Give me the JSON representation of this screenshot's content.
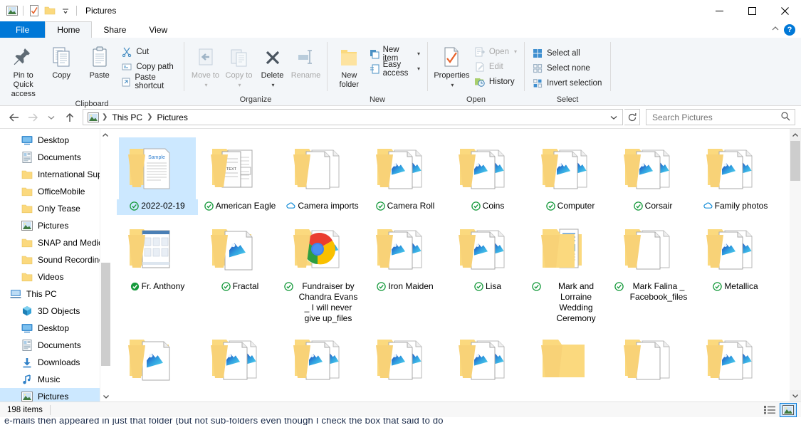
{
  "window": {
    "title": "Pictures",
    "quick_access_icons": [
      "picture-folder-icon",
      "checkmark-doc-icon",
      "folder-icon",
      "customize-dropdown-icon"
    ],
    "controls": {
      "minimize": "minimize-icon",
      "maximize": "maximize-icon",
      "close": "close-icon"
    }
  },
  "tabs": [
    {
      "label": "File",
      "id": "file"
    },
    {
      "label": "Home",
      "id": "home"
    },
    {
      "label": "Share",
      "id": "share"
    },
    {
      "label": "View",
      "id": "view"
    }
  ],
  "tab_right": {
    "collapse": "chevron-up-icon",
    "help": "?"
  },
  "ribbon": {
    "groups": [
      {
        "name": "Clipboard",
        "label": "Clipboard",
        "big_buttons": [
          {
            "label": "Pin to Quick access",
            "icon": "pin-icon",
            "dim": false
          },
          {
            "label": "Copy",
            "icon": "copy-icon",
            "dim": false
          },
          {
            "label": "Paste",
            "icon": "paste-icon",
            "dim": false
          }
        ],
        "small_buttons": [
          {
            "label": "Cut",
            "icon": "scissors-icon",
            "dim": false
          },
          {
            "label": "Copy path",
            "icon": "copy-path-icon",
            "dim": false
          },
          {
            "label": "Paste shortcut",
            "icon": "paste-shortcut-icon",
            "dim": false
          }
        ]
      },
      {
        "name": "Organize",
        "label": "Organize",
        "big_buttons": [
          {
            "label": "Move to",
            "icon": "move-to-icon",
            "dim": true,
            "caret": true
          },
          {
            "label": "Copy to",
            "icon": "copy-to-icon",
            "dim": true,
            "caret": true
          },
          {
            "label": "Delete",
            "icon": "delete-x-icon",
            "dim": false,
            "caret": true
          },
          {
            "label": "Rename",
            "icon": "rename-icon",
            "dim": true
          }
        ]
      },
      {
        "name": "New",
        "label": "New",
        "big_buttons": [
          {
            "label": "New folder",
            "icon": "new-folder-icon",
            "dim": false
          }
        ],
        "small_buttons": [
          {
            "label": "New item",
            "icon": "new-item-icon",
            "dim": false,
            "caret": true
          },
          {
            "label": "Easy access",
            "icon": "easy-access-icon",
            "dim": false,
            "caret": true
          }
        ]
      },
      {
        "name": "Open",
        "label": "Open",
        "big_buttons": [
          {
            "label": "Properties",
            "icon": "properties-icon",
            "dim": false,
            "caret": true
          }
        ],
        "small_buttons": [
          {
            "label": "Open",
            "icon": "open-icon",
            "dim": true,
            "caret": true
          },
          {
            "label": "Edit",
            "icon": "edit-icon",
            "dim": true
          },
          {
            "label": "History",
            "icon": "history-icon",
            "dim": false
          }
        ]
      },
      {
        "name": "Select",
        "label": "Select",
        "small_buttons": [
          {
            "label": "Select all",
            "icon": "select-all-icon",
            "dim": false
          },
          {
            "label": "Select none",
            "icon": "select-none-icon",
            "dim": false
          },
          {
            "label": "Invert selection",
            "icon": "invert-selection-icon",
            "dim": false
          }
        ]
      }
    ]
  },
  "addressbar": {
    "back": "back-arrow-icon",
    "forward": "forward-arrow-icon",
    "recent": "chevron-down-icon",
    "up": "up-arrow-icon",
    "location_icon": "pictures-icon",
    "breadcrumbs": [
      "This PC",
      "Pictures"
    ],
    "dropdown": "chevron-down-icon",
    "refresh": "refresh-icon",
    "search_placeholder": "Search Pictures",
    "search_value": "",
    "search_icon": "search-icon"
  },
  "navpane": {
    "items": [
      {
        "label": "Desktop",
        "icon": "desktop-icon",
        "level": 1,
        "selected": false
      },
      {
        "label": "Documents",
        "icon": "documents-icon",
        "level": 1,
        "selected": false
      },
      {
        "label": "International Sup",
        "icon": "folder-icon",
        "level": 1,
        "selected": false
      },
      {
        "label": "OfficeMobile",
        "icon": "folder-icon",
        "level": 1,
        "selected": false
      },
      {
        "label": "Only Tease",
        "icon": "folder-icon",
        "level": 1,
        "selected": false
      },
      {
        "label": "Pictures",
        "icon": "pictures-icon",
        "level": 1,
        "selected": false
      },
      {
        "label": "SNAP and Medic",
        "icon": "folder-icon",
        "level": 1,
        "selected": false
      },
      {
        "label": "Sound Recording",
        "icon": "folder-icon",
        "level": 1,
        "selected": false
      },
      {
        "label": "Videos",
        "icon": "folder-icon",
        "level": 1,
        "selected": false
      },
      {
        "label": "This PC",
        "icon": "this-pc-icon",
        "level": 0,
        "selected": false
      },
      {
        "label": "3D Objects",
        "icon": "3d-objects-icon",
        "level": 1,
        "selected": false
      },
      {
        "label": "Desktop",
        "icon": "desktop-icon",
        "level": 1,
        "selected": false
      },
      {
        "label": "Documents",
        "icon": "documents-icon",
        "level": 1,
        "selected": false
      },
      {
        "label": "Downloads",
        "icon": "downloads-icon",
        "level": 1,
        "selected": false
      },
      {
        "label": "Music",
        "icon": "music-icon",
        "level": 1,
        "selected": false
      },
      {
        "label": "Pictures",
        "icon": "pictures-icon",
        "level": 1,
        "selected": true
      }
    ],
    "scroll_up": "chevron-up-icon",
    "scroll_down": "chevron-down-icon"
  },
  "files": [
    {
      "name": "2022-02-19",
      "sync": "synced",
      "thumb": "doc-preview",
      "selected": true
    },
    {
      "name": "American Eagle",
      "sync": "synced",
      "thumb": "doc-pages",
      "selected": false
    },
    {
      "name": "Camera imports",
      "sync": "cloud",
      "thumb": "plain",
      "selected": false
    },
    {
      "name": "Camera Roll",
      "sync": "synced",
      "thumb": "photo",
      "selected": false
    },
    {
      "name": "Coins",
      "sync": "synced",
      "thumb": "photo",
      "selected": false
    },
    {
      "name": "Computer",
      "sync": "synced",
      "thumb": "photo",
      "selected": false
    },
    {
      "name": "Corsair",
      "sync": "synced",
      "thumb": "photo",
      "selected": false
    },
    {
      "name": "Family photos",
      "sync": "cloud",
      "thumb": "photo",
      "selected": false
    },
    {
      "name": "Fr. Anthony",
      "sync": "always",
      "thumb": "webpage",
      "selected": false
    },
    {
      "name": "Fractal",
      "sync": "synced",
      "thumb": "single-photo",
      "selected": false
    },
    {
      "name": "Fundraiser by Chandra Evans _ I will never give up_files",
      "sync": "synced",
      "thumb": "chrome",
      "selected": false
    },
    {
      "name": "Iron Maiden",
      "sync": "synced",
      "thumb": "photo",
      "selected": false
    },
    {
      "name": "Lisa",
      "sync": "synced",
      "thumb": "photo",
      "selected": false
    },
    {
      "name": "Mark and Lorraine Wedding Ceremony",
      "sync": "synced",
      "thumb": "lines",
      "selected": false
    },
    {
      "name": "Mark Falina _ Facebook_files",
      "sync": "synced",
      "thumb": "plain",
      "selected": false
    },
    {
      "name": "Metallica",
      "sync": "synced",
      "thumb": "photo",
      "selected": false
    },
    {
      "name": "",
      "sync": "none",
      "thumb": "single-photo",
      "selected": false
    },
    {
      "name": "",
      "sync": "none",
      "thumb": "photo",
      "selected": false
    },
    {
      "name": "",
      "sync": "none",
      "thumb": "photo",
      "selected": false
    },
    {
      "name": "",
      "sync": "none",
      "thumb": "photo",
      "selected": false
    },
    {
      "name": "",
      "sync": "none",
      "thumb": "photo",
      "selected": false
    },
    {
      "name": "",
      "sync": "none",
      "thumb": "plain-folder",
      "selected": false
    },
    {
      "name": "",
      "sync": "none",
      "thumb": "plain",
      "selected": false
    },
    {
      "name": "",
      "sync": "none",
      "thumb": "photo",
      "selected": false
    }
  ],
  "statusbar": {
    "item_count": "198 items",
    "view_details": "details-view-icon",
    "view_large_icons": "large-icons-view-icon",
    "active_view": "large-icons"
  },
  "underlay": {
    "text": "e-mails then appeared in just that folder (but not sub-folders even though I check the box that said to do"
  },
  "colors": {
    "accent": "#0078d7",
    "selection": "#cce8ff",
    "ribbon_bg": "#f3f6f9",
    "folder": "#fbd97e",
    "sync_green": "#1a9c3e",
    "sync_cloud": "#0a84d8"
  }
}
